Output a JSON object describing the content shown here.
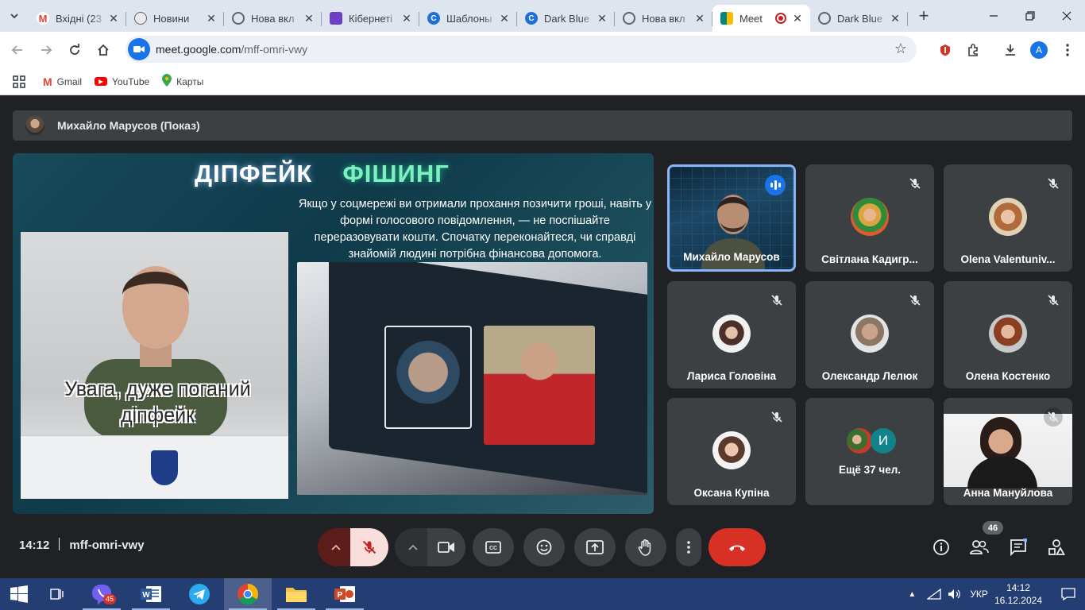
{
  "browser": {
    "tabs": [
      {
        "title": "Вхідні (23",
        "icon": "gmail-icon",
        "color": "#ea4335",
        "active": false
      },
      {
        "title": "Новини",
        "icon": "news-icon",
        "color": "#5f6368",
        "active": false
      },
      {
        "title": "Нова вкл",
        "icon": "globe-icon",
        "color": "#5f6368",
        "active": false
      },
      {
        "title": "Кібернеті",
        "icon": "purple-app-icon",
        "color": "#6c3fc5",
        "active": false
      },
      {
        "title": "Шаблоны",
        "icon": "canva-icon",
        "color": "#1e6fd9",
        "active": false
      },
      {
        "title": "Dark Blue",
        "icon": "canva-icon",
        "color": "#1e6fd9",
        "active": false
      },
      {
        "title": "Нова вкл",
        "icon": "globe-icon",
        "color": "#5f6368",
        "active": false
      },
      {
        "title": "Meet",
        "icon": "meet-icon",
        "color": "#00897b",
        "active": true
      },
      {
        "title": "Dark Blue",
        "icon": "globe-icon",
        "color": "#5f6368",
        "active": false
      }
    ],
    "url_host": "meet.google.com",
    "url_path": "/mff-omri-vwy",
    "profile_initial": "A",
    "bookmarks": [
      {
        "label": "Gmail",
        "icon": "gmail-icon"
      },
      {
        "label": "YouTube",
        "icon": "youtube-icon"
      },
      {
        "label": "Карты",
        "icon": "maps-pin-icon"
      }
    ]
  },
  "meet": {
    "presenter_label": "Михайло Марусов (Показ)",
    "slide": {
      "title_part1": "ДІПФЕЙК",
      "title_part2": "ФІШИНГ",
      "body": "Якщо у соцмережі ви отримали прохання позичити гроші, навіть у формі голосового повідомлення, — не поспішайте переразовувати кошти. Спочатку переконайтеся, чи справді знайомій людині потрібна фінансова допомога.",
      "video_caption": "Увага, дуже поганий діпфейк"
    },
    "participants": [
      {
        "name": "Михайло Марусов",
        "speaking": true
      },
      {
        "name": "Світлана Кадигр...",
        "muted": true,
        "avatar": "#d9a441"
      },
      {
        "name": "Olena Valentuniv...",
        "muted": true,
        "avatar": "#b06a3b"
      },
      {
        "name": "Лариса Головіна",
        "muted": true,
        "avatar": "#4a2f2a"
      },
      {
        "name": "Олександр Лелюк",
        "muted": true,
        "avatar": "#8c7665"
      },
      {
        "name": "Олена Костенко",
        "muted": true,
        "avatar": "#8a3f23"
      },
      {
        "name": "Оксана Купіна",
        "muted": true,
        "avatar": "#5b3a2e"
      },
      {
        "name": "Ещё 37 чел.",
        "more_initial": "И"
      },
      {
        "name": "Анна Мануйлова",
        "muted": true
      }
    ],
    "time": "14:12",
    "meeting_code": "mff-omri-vwy",
    "participant_count": "46"
  },
  "taskbar": {
    "viber_badge": "45",
    "language": "УКР",
    "clock_time": "14:12",
    "clock_date": "16.12.2024"
  }
}
